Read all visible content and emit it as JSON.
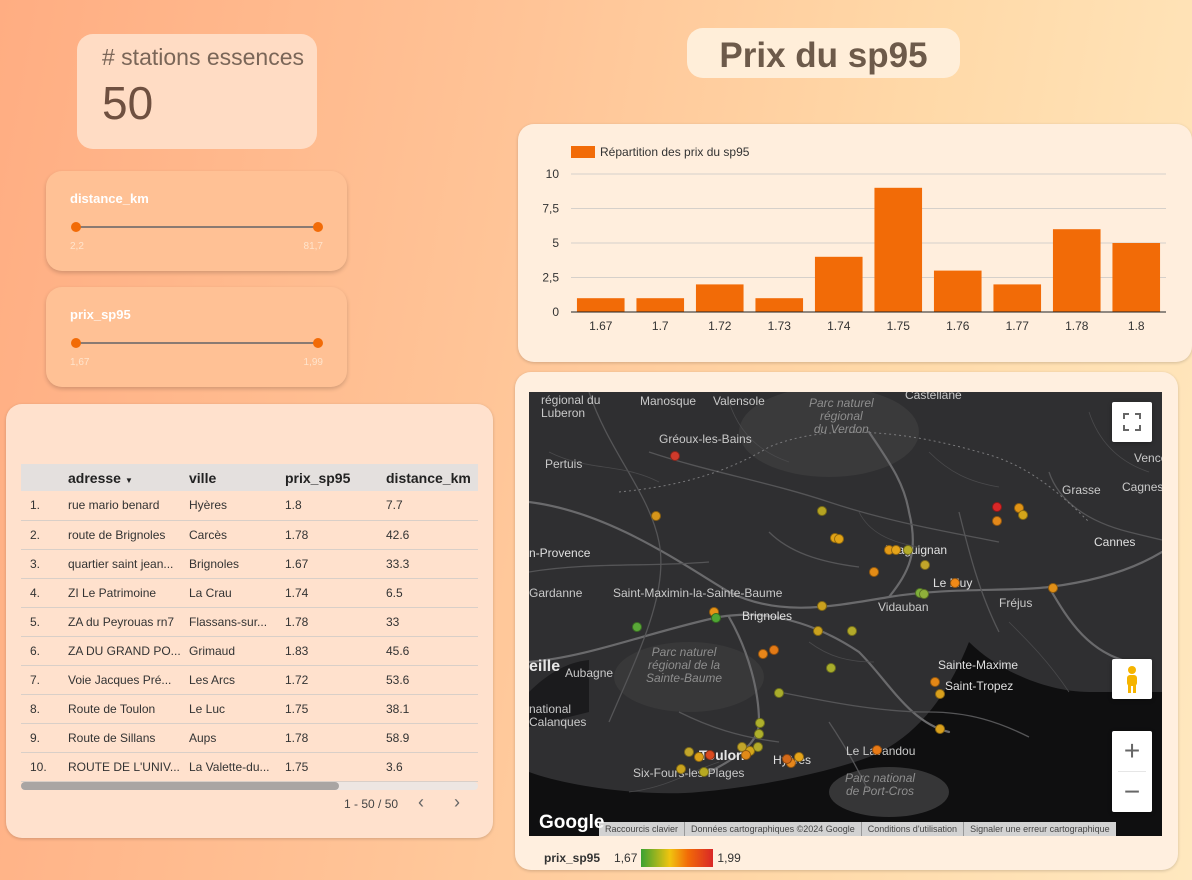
{
  "scorecard": {
    "label": "# stations essences",
    "value": "50"
  },
  "title": "Prix du sp95",
  "sliders": [
    {
      "name": "distance_km",
      "min": "2,2",
      "max": "81,7"
    },
    {
      "name": "prix_sp95",
      "min": "1,67",
      "max": "1,99"
    }
  ],
  "table": {
    "columns": [
      "adresse",
      "ville",
      "prix_sp95",
      "distance_km"
    ],
    "rows": [
      [
        "1.",
        "rue mario benard",
        "Hyères",
        "1.8",
        "7.7"
      ],
      [
        "2.",
        "route de Brignoles",
        "Carcès",
        "1.78",
        "42.6"
      ],
      [
        "3.",
        "quartier saint jean...",
        "Brignoles",
        "1.67",
        "33.3"
      ],
      [
        "4.",
        "ZI Le Patrimoine",
        "La Crau",
        "1.74",
        "6.5"
      ],
      [
        "5.",
        "ZA du Peyrouas rn7",
        "Flassans-sur...",
        "1.78",
        "33"
      ],
      [
        "6.",
        "ZA DU GRAND PO...",
        "Grimaud",
        "1.83",
        "45.6"
      ],
      [
        "7.",
        "Voie Jacques Pré...",
        "Les Arcs",
        "1.72",
        "53.6"
      ],
      [
        "8.",
        "Route de Toulon",
        "Le Luc",
        "1.75",
        "38.1"
      ],
      [
        "9.",
        "Route de Sillans",
        "Aups",
        "1.78",
        "58.9"
      ],
      [
        "10.",
        "ROUTE DE L'UNIV...",
        "La Valette-du...",
        "1.75",
        "3.6"
      ]
    ],
    "pagination": "1 - 50 / 50",
    "prev_icon": "chevron-left-icon",
    "next_icon": "chevron-right-icon"
  },
  "chart_data": {
    "type": "bar",
    "title": "",
    "legend": "Répartition des prix du sp95",
    "categories": [
      "1.67",
      "1.7",
      "1.72",
      "1.73",
      "1.74",
      "1.75",
      "1.76",
      "1.77",
      "1.78",
      "1.8"
    ],
    "values": [
      1,
      1,
      2,
      1,
      4,
      9,
      3,
      2,
      6,
      5
    ],
    "yticks": [
      "0",
      "2,5",
      "5",
      "7,5",
      "10"
    ],
    "ylim": [
      0,
      10
    ],
    "grid": true,
    "legend_position": "top-left",
    "color": "#f26b07"
  },
  "map": {
    "places": {
      "manosque": "Manosque",
      "valensole": "Valensole",
      "castellane": "Castellane",
      "luberon": "régional du\nLuberon",
      "verdon": "Parc naturel\nrégional\ndu Verdon",
      "greoux": "Gréoux-les-Bains",
      "pertuis": "Pertuis",
      "vence": "Vence",
      "grasse": "Grasse",
      "cagnes": "Cagnes",
      "aix": "n-Provence",
      "cannes": "Cannes",
      "draguignan": "Draguignan",
      "gardanne": "Gardanne",
      "stmaximin": "Saint-Maximin-la-Sainte-Baume",
      "lemuy": "Le Muy",
      "vidauban": "Vidauban",
      "frejus": "Fréjus",
      "brignoles": "Brignoles",
      "saintebaume": "Parc naturel\nrégional de la\nSainte-Baume",
      "marseille": "eille",
      "aubagne": "Aubagne",
      "ste_maxime": "Sainte-Maxime",
      "st_tropez": "Saint-Tropez",
      "calanques": "national\nCalanques",
      "lelavandou": "Le Lavandou",
      "toulon": "Toulon",
      "hyeres": "Hyères",
      "sixfours": "Six-Fours-les-Plages",
      "portcros": "Parc national\nde Port-Cros"
    },
    "google_logo": "Google",
    "attribution": [
      "Raccourcis clavier",
      "Données cartographiques ©2024 Google",
      "Conditions d'utilisation",
      "Signaler une erreur cartographique"
    ],
    "zoom_in": "+",
    "zoom_out": "−",
    "legend": {
      "name": "prix_sp95",
      "min": "1,67",
      "max": "1,99"
    }
  }
}
